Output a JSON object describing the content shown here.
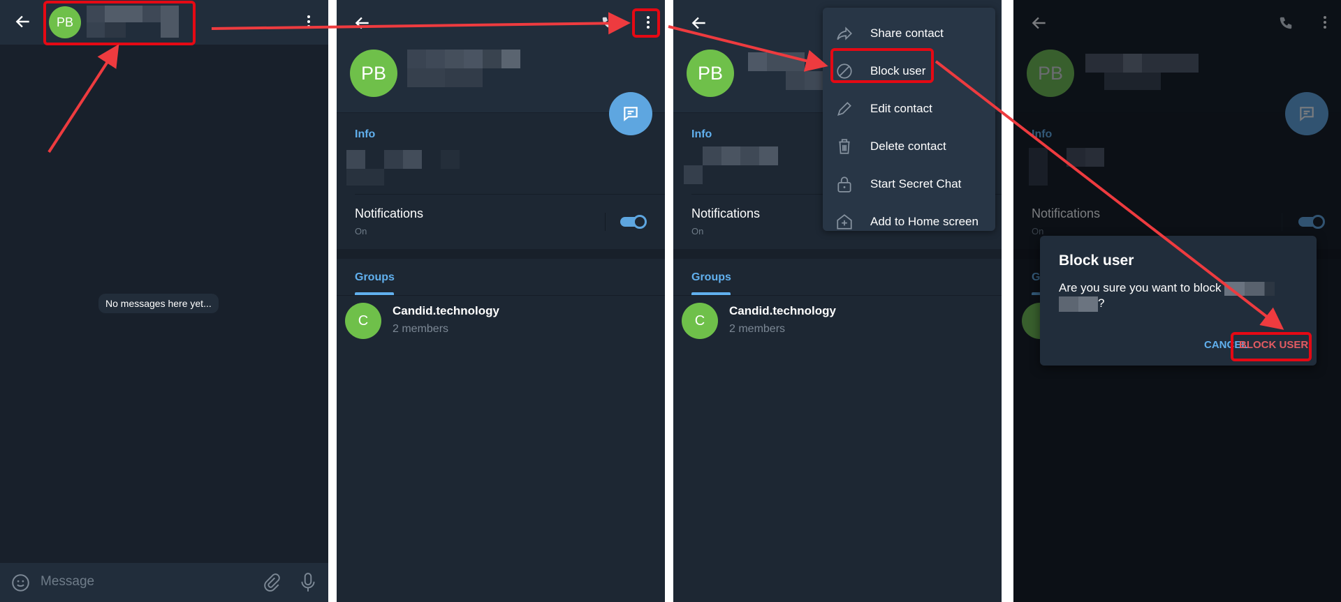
{
  "colors": {
    "accent": "#61b0ee",
    "avatar_green": "#6fc04a",
    "danger": "#e45b62",
    "annotation_red": "#e50914",
    "header_bg": "#212d3b",
    "chat_bg": "#18202b"
  },
  "panel1": {
    "avatar_initials": "PB",
    "contact_name": "[redacted]",
    "empty_state": "No messages here yet...",
    "composer_placeholder": "Message",
    "icons": [
      "back-arrow-icon",
      "more-vert-icon",
      "emoji-icon",
      "attach-icon",
      "mic-icon"
    ]
  },
  "panel2": {
    "avatar_initials": "PB",
    "contact_name": "[redacted]",
    "info_label": "Info",
    "notifications_title": "Notifications",
    "notifications_state": "On",
    "notifications_enabled": true,
    "groups_label": "Groups",
    "group": {
      "avatar_initial": "C",
      "name": "Candid.technology",
      "members": "2 members"
    }
  },
  "panel3": {
    "avatar_initials": "PB",
    "info_label": "Info",
    "notifications_title": "Notifications",
    "notifications_state": "On",
    "groups_label": "Groups",
    "group": {
      "avatar_initial": "C",
      "name": "Candid.technology",
      "members": "2 members"
    },
    "menu": [
      {
        "label": "Share contact",
        "icon": "share-icon"
      },
      {
        "label": "Block user",
        "icon": "block-icon",
        "highlighted": true
      },
      {
        "label": "Edit contact",
        "icon": "pencil-icon"
      },
      {
        "label": "Delete contact",
        "icon": "trash-icon"
      },
      {
        "label": "Start Secret Chat",
        "icon": "lock-icon"
      },
      {
        "label": "Add to Home screen",
        "icon": "add-home-icon"
      }
    ]
  },
  "panel4": {
    "avatar_initials": "PB",
    "info_label": "Info",
    "notifications_title": "Notifications",
    "notifications_state": "On",
    "groups_label": "G",
    "dialog": {
      "title": "Block user",
      "body_prefix": "Are you sure you want to block",
      "body_suffix": "?",
      "cancel_label": "CANCEL",
      "confirm_label": "BLOCK USER"
    }
  }
}
